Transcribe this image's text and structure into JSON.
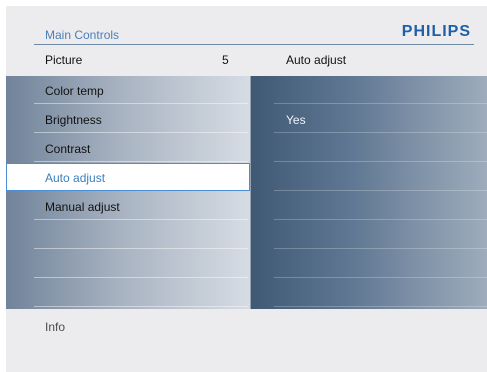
{
  "header": {
    "title": "Main Controls",
    "brand": "PHILIPS"
  },
  "top_row": {
    "picture_label": "Picture",
    "picture_value": "5",
    "right_title": "Auto adjust"
  },
  "menu": {
    "items": [
      {
        "label": "Color temp"
      },
      {
        "label": "Brightness"
      },
      {
        "label": "Contrast"
      },
      {
        "label": "Auto adjust"
      },
      {
        "label": "Manual adjust"
      },
      {
        "label": ""
      },
      {
        "label": ""
      },
      {
        "label": ""
      }
    ],
    "selected_index": 3
  },
  "options": {
    "items": [
      {
        "label": ""
      },
      {
        "label": "Yes"
      },
      {
        "label": ""
      },
      {
        "label": ""
      },
      {
        "label": ""
      },
      {
        "label": ""
      },
      {
        "label": ""
      },
      {
        "label": ""
      }
    ]
  },
  "footer": {
    "info_label": "Info"
  }
}
